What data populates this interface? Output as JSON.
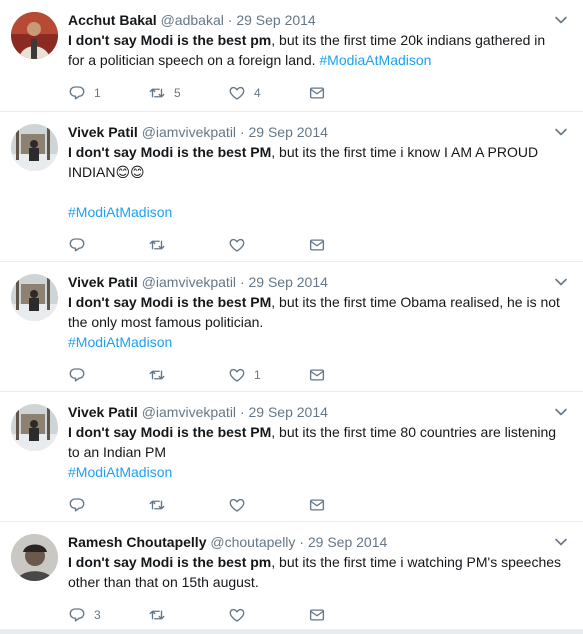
{
  "tweets": [
    {
      "name": "Acchut Bakal",
      "handle": "@adbakal",
      "time": "29 Sep 2014",
      "bold": "I don't  say Modi is the best pm",
      "rest": ", but its the first time 20k indians gathered in for a politician speech on a foreign land. ",
      "extra": "",
      "hashtag": "#ModiaAtMadison",
      "hashtag_block": false,
      "reply_count": "1",
      "retweet_count": "5",
      "like_count": "4",
      "avatar": "red-person"
    },
    {
      "name": "Vivek Patil",
      "handle": "@iamvivekpatil",
      "time": "29 Sep 2014",
      "bold": "I don't say Modi is the best PM",
      "rest": ", but its the first time i know I AM A PROUD INDIAN",
      "extra": "😊😊",
      "hashtag": "#ModiAtMadison",
      "hashtag_block": true,
      "reply_count": "",
      "retweet_count": "",
      "like_count": "",
      "avatar": "outdoor-person"
    },
    {
      "name": "Vivek Patil",
      "handle": "@iamvivekpatil",
      "time": "29 Sep 2014",
      "bold": "I don't say Modi is the best PM",
      "rest": ", but its the first time Obama realised, he is not the only most famous politician.",
      "extra": "",
      "hashtag": "#ModiAtMadison",
      "hashtag_block": false,
      "hashtag_newline": true,
      "reply_count": "",
      "retweet_count": "",
      "like_count": "1",
      "avatar": "outdoor-person"
    },
    {
      "name": "Vivek Patil",
      "handle": "@iamvivekpatil",
      "time": "29 Sep 2014",
      "bold": "I don't say Modi is the best PM",
      "rest": ", but its the first time 80 countries are listening to an Indian PM",
      "extra": "",
      "hashtag": "#ModiAtMadison",
      "hashtag_block": false,
      "hashtag_newline": true,
      "reply_count": "",
      "retweet_count": "",
      "like_count": "",
      "avatar": "outdoor-person"
    },
    {
      "name": "Ramesh Choutapelly",
      "handle": "@choutapelly",
      "time": "29 Sep 2014",
      "bold": "I don't say Modi is the best pm",
      "rest": ", but its the first time i watching PM's speeches other than that on 15th august.",
      "extra": "",
      "hashtag": "",
      "hashtag_block": false,
      "reply_count": "3",
      "retweet_count": "",
      "like_count": "",
      "avatar": "gray-person"
    }
  ],
  "icons": {
    "reply": "reply-icon",
    "retweet": "retweet-icon",
    "like": "heart-icon",
    "dm": "envelope-icon",
    "caret": "chevron-down-icon"
  },
  "colors": {
    "hashtag": "#1da1f2",
    "secondary": "#657786",
    "background": "#e6ecf0"
  }
}
